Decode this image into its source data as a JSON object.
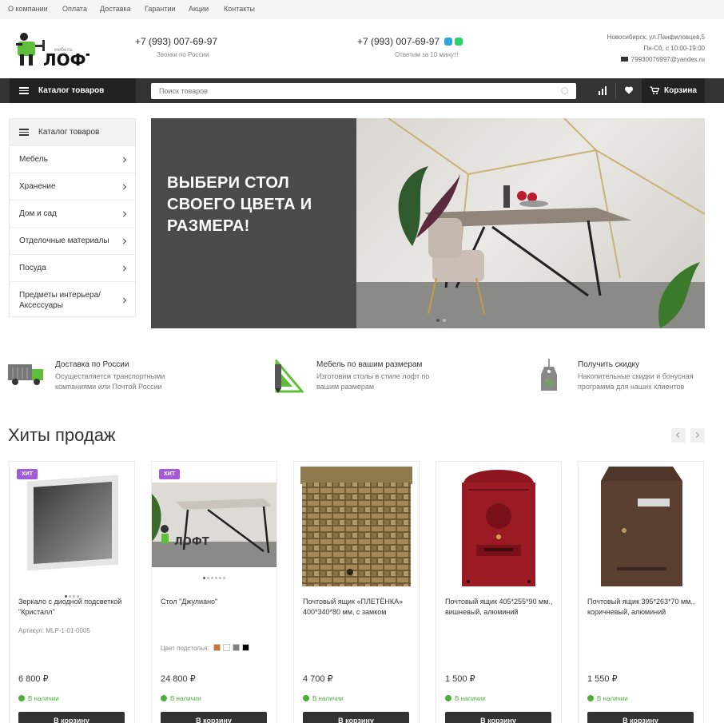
{
  "top_nav": [
    "О компании",
    "Оплата",
    "Доставка",
    "Гарантии",
    "Акции",
    "Контакты"
  ],
  "header": {
    "logo_text": "ЛОФТ",
    "logo_sub": "мебель",
    "phone1": "+7 (993) 007-69-97",
    "phone1_sub": "Звонки по России",
    "phone2": "+7 (993) 007-69-97",
    "phone2_sub": "Ответим за 10 минут!",
    "address": "Новосибирск, ул.Панфиловцев,5",
    "hours": "Пн-Сб, с 10:00-19:00",
    "email": "79930076997@yandex.ru"
  },
  "mainbar": {
    "catalog_label": "Каталог товаров",
    "search_placeholder": "Поиск товаров",
    "cart_label": "Корзина"
  },
  "sidebar": {
    "title": "Каталог товаров",
    "items": [
      "Мебель",
      "Хранение",
      "Дом и сад",
      "Отделочные материалы",
      "Посуда",
      "Предметы интерьера/ Аксессуары"
    ]
  },
  "banner": {
    "title": "ВЫБЕРИ СТОЛ СВОЕГО ЦВЕТА И РАЗМЕРА!"
  },
  "features": [
    {
      "title": "Доставка по России",
      "desc": "Осуществляется транспортными компаниями или Почтой России"
    },
    {
      "title": "Мебель по вашим размерам",
      "desc": "Изготовим столы в стиле лофт по вашим размерам"
    },
    {
      "title": "Получить скидку",
      "desc": "Накопительные скидки и бонусная программа для наших клиентов"
    }
  ],
  "hits": {
    "title": "Хиты продаж",
    "products": [
      {
        "badge": "ХИТ",
        "name": "Зеркало с диодной подсветкой \"Кристалл\"",
        "article": "Артикул: MLP-1-01-0005",
        "price": "6 800 ₽",
        "stock": "В наличии",
        "buy": "В корзину"
      },
      {
        "badge": "ХИТ",
        "name": "Стол \"Джулиано\"",
        "color_label": "Цвет подстолья:",
        "price": "24 800 ₽",
        "stock": "В наличии",
        "buy": "В корзину"
      },
      {
        "name": "Почтовый ящик «ПЛЕТЁНКА» 400*340*80 мм, с замком",
        "price": "4 700 ₽",
        "stock": "В наличии",
        "buy": "В корзину"
      },
      {
        "name": "Почтовый ящик 405*255*90 мм., вишневый, алюминий",
        "price": "1 500 ₽",
        "stock": "В наличии",
        "buy": "В корзину"
      },
      {
        "name": "Почтовый ящик 395*263*70 мм., коричневый, алюминий",
        "price": "1 550 ₽",
        "stock": "В наличии",
        "buy": "В корзину"
      }
    ]
  },
  "colors": {
    "accent": "#a15bd8",
    "bar": "#333333",
    "stock_green": "#4caf3b",
    "logo_green": "#5fbf3a",
    "swatches": [
      "#c8782e",
      "#ffffff",
      "#808080",
      "#000000"
    ]
  }
}
